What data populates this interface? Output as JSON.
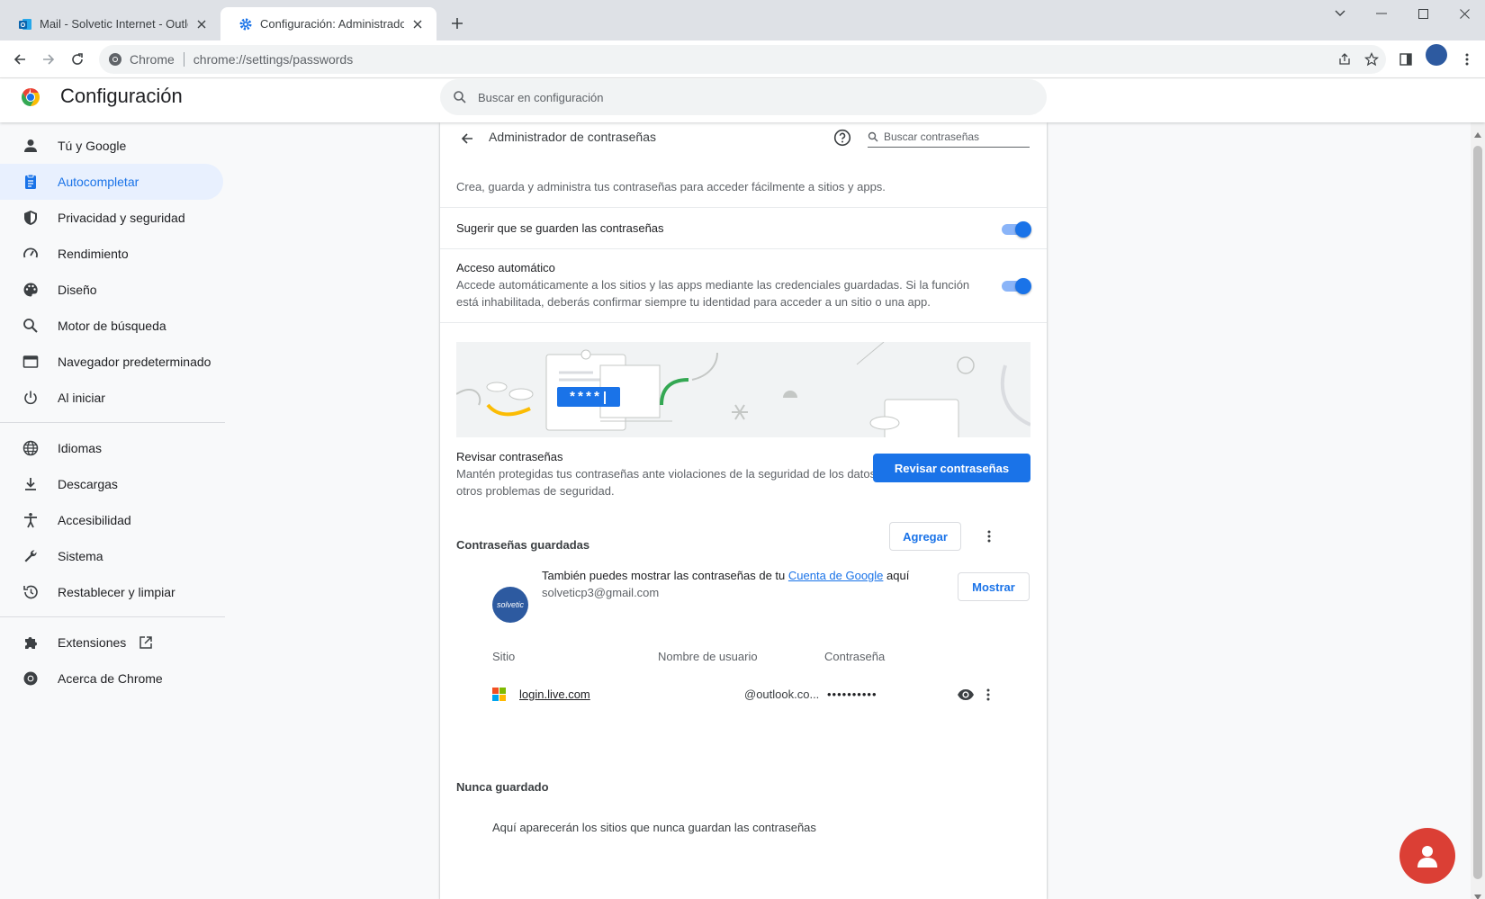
{
  "browser": {
    "tabs": [
      {
        "title": "Mail - Solvetic Internet - Outlook",
        "favicon": "outlook-icon",
        "active": false
      },
      {
        "title": "Configuración: Administrador de contraseñas",
        "favicon": "gear-icon",
        "active": true
      }
    ],
    "omnibox": {
      "chip": "Chrome",
      "url": "chrome://settings/passwords"
    }
  },
  "settings": {
    "title": "Configuración",
    "search_placeholder": "Buscar en configuración"
  },
  "sidebar": {
    "items": [
      {
        "label": "Tú y Google",
        "icon": "person-icon"
      },
      {
        "label": "Autocompletar",
        "icon": "autofill-icon",
        "selected": true
      },
      {
        "label": "Privacidad y seguridad",
        "icon": "shield-icon"
      },
      {
        "label": "Rendimiento",
        "icon": "speedometer-icon"
      },
      {
        "label": "Diseño",
        "icon": "palette-icon"
      },
      {
        "label": "Motor de búsqueda",
        "icon": "search-icon"
      },
      {
        "label": "Navegador predeterminado",
        "icon": "browser-window-icon"
      },
      {
        "label": "Al iniciar",
        "icon": "power-icon"
      },
      {
        "label": "Idiomas",
        "icon": "globe-icon"
      },
      {
        "label": "Descargas",
        "icon": "download-icon"
      },
      {
        "label": "Accesibilidad",
        "icon": "accessibility-icon"
      },
      {
        "label": "Sistema",
        "icon": "wrench-icon"
      },
      {
        "label": "Restablecer y limpiar",
        "icon": "restore-icon"
      },
      {
        "label": "Extensiones",
        "icon": "puzzle-icon"
      },
      {
        "label": "Acerca de Chrome",
        "icon": "chrome-icon"
      }
    ]
  },
  "card": {
    "title": "Administrador de contraseñas",
    "search_placeholder": "Buscar contraseñas",
    "intro": "Crea, guarda y administra tus contraseñas para acceder fácilmente a sitios y apps.",
    "offer_save": {
      "label": "Sugerir que se guarden las contraseñas",
      "enabled": true
    },
    "auto_signin": {
      "label": "Acceso automático",
      "desc1": "Accede automáticamente a los sitios y las apps mediante las credenciales guardadas. Si la función",
      "desc2": "está inhabilitada, deberás confirmar siempre tu identidad para acceder a un sitio o una app.",
      "enabled": true
    },
    "banner": {
      "masked": "****|"
    },
    "check": {
      "title": "Revisar contraseñas",
      "desc1": "Mantén protegidas tus contraseñas ante violaciones de la seguridad de los datos y",
      "desc2": "otros problemas de seguridad.",
      "button": "Revisar contraseñas"
    },
    "saved": {
      "title": "Contraseñas guardadas",
      "add_button": "Agregar",
      "account_text_before": "También puedes mostrar las contraseñas de tu ",
      "account_link": "Cuenta de Google",
      "account_text_after": " aquí",
      "email": "solveticp3@gmail.com",
      "avatar_text": "solvetic",
      "show_button": "Mostrar",
      "columns": {
        "site": "Sitio",
        "user": "Nombre de usuario",
        "password": "Contraseña"
      },
      "rows": [
        {
          "site": "login.live.com",
          "user": "@outlook.co...",
          "password": "••••••••••"
        }
      ]
    },
    "never": {
      "title": "Nunca guardado",
      "empty": "Aquí aparecerán los sitios que nunca guardan las contraseñas"
    }
  },
  "colors": {
    "accent": "#1a73e8",
    "selected_bg": "#e8f0fe",
    "toggle_track": "#8ab4f8"
  }
}
